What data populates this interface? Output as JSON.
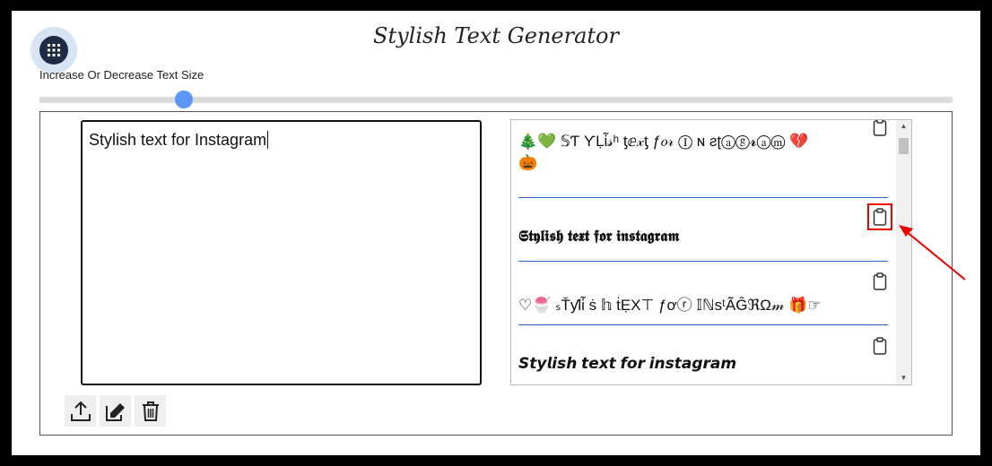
{
  "title": "Stylish Text Generator",
  "size_label": "Increase Or Decrease Text Size",
  "slider": {
    "value_fraction": 0.16
  },
  "input_text": "Stylish text for Instagram",
  "toolbar": {
    "icons": [
      "upload-icon",
      "edit-icon",
      "trash-icon"
    ]
  },
  "results": [
    {
      "line1": "🎄💚 𝕊Ƭ ƳḶἷ𝓈ʰ ƫⅇ𝓍ƫ ƒ𝑜𝓇 Ⓘ ɴ ƨʈⓐⓖ𝓻ⓐⓜ 💔",
      "line2": "🎃"
    },
    {
      "line1": "𝕾𝖙𝖞𝖑𝖎𝖘𝖍 𝖙𝖊𝖝𝖙 𝖋𝖔𝖗 𝖎𝖓𝖘𝖙𝖆𝖌𝖗𝖆𝖒"
    },
    {
      "line1": "♡🍧 ₛŤƴlἷ ṡ 𝕙 ṫẸХ⊤ ƒơⓡ 𝕀ℕsᵗÃĜℜΩ𝓂 🎁☞"
    },
    {
      "line1": "𝙎𝙩𝙮𝙡𝙞𝙨𝙝 𝙩𝙚𝙭𝙩 𝙛𝙤𝙧 𝙞𝙣𝙨𝙩𝙖𝙜𝙧𝙖𝙢"
    }
  ],
  "colors": {
    "accent": "#5b97f5",
    "divider": "#2a62b8",
    "highlight": "#e00000"
  },
  "icons": {
    "apps": "apps-grid-icon",
    "copy": "clipboard-icon"
  }
}
